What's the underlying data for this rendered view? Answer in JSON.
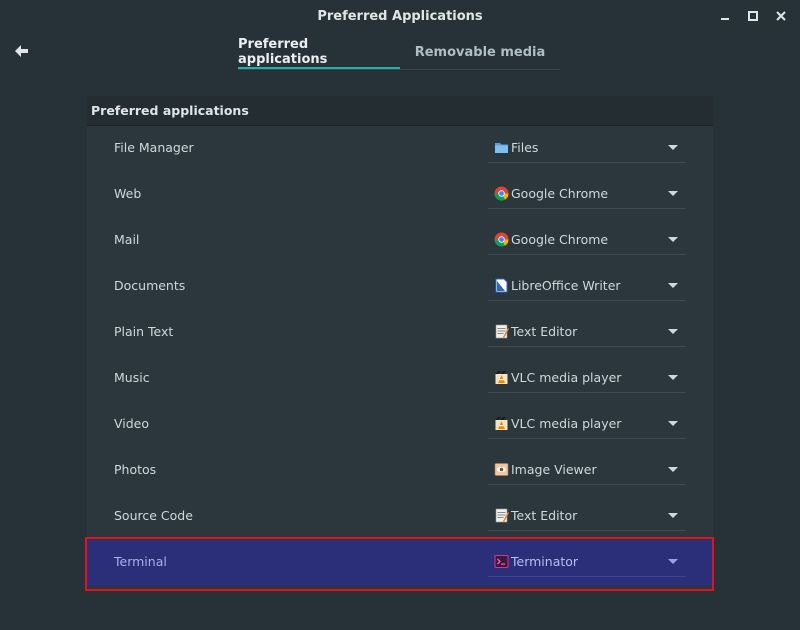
{
  "window": {
    "title": "Preferred Applications"
  },
  "tabs": [
    {
      "label": "Preferred applications",
      "active": true
    },
    {
      "label": "Removable media",
      "active": false
    }
  ],
  "panel": {
    "title": "Preferred applications"
  },
  "rows": [
    {
      "label": "File Manager",
      "value": "Files",
      "icon": "folder-icon"
    },
    {
      "label": "Web",
      "value": "Google Chrome",
      "icon": "chrome-icon"
    },
    {
      "label": "Mail",
      "value": "Google Chrome",
      "icon": "chrome-icon"
    },
    {
      "label": "Documents",
      "value": "LibreOffice Writer",
      "icon": "libreoffice-writer-icon"
    },
    {
      "label": "Plain Text",
      "value": "Text Editor",
      "icon": "text-editor-icon"
    },
    {
      "label": "Music",
      "value": "VLC media player",
      "icon": "vlc-icon"
    },
    {
      "label": "Video",
      "value": "VLC media player",
      "icon": "vlc-icon"
    },
    {
      "label": "Photos",
      "value": "Image Viewer",
      "icon": "image-viewer-icon"
    },
    {
      "label": "Source Code",
      "value": "Text Editor",
      "icon": "text-editor-icon"
    },
    {
      "label": "Terminal",
      "value": "Terminator",
      "icon": "terminator-icon",
      "selected": true
    }
  ],
  "colors": {
    "background": "#263238",
    "accent": "#1eb3a4",
    "selection": "#2b2e78",
    "highlight": "#e0141e"
  }
}
